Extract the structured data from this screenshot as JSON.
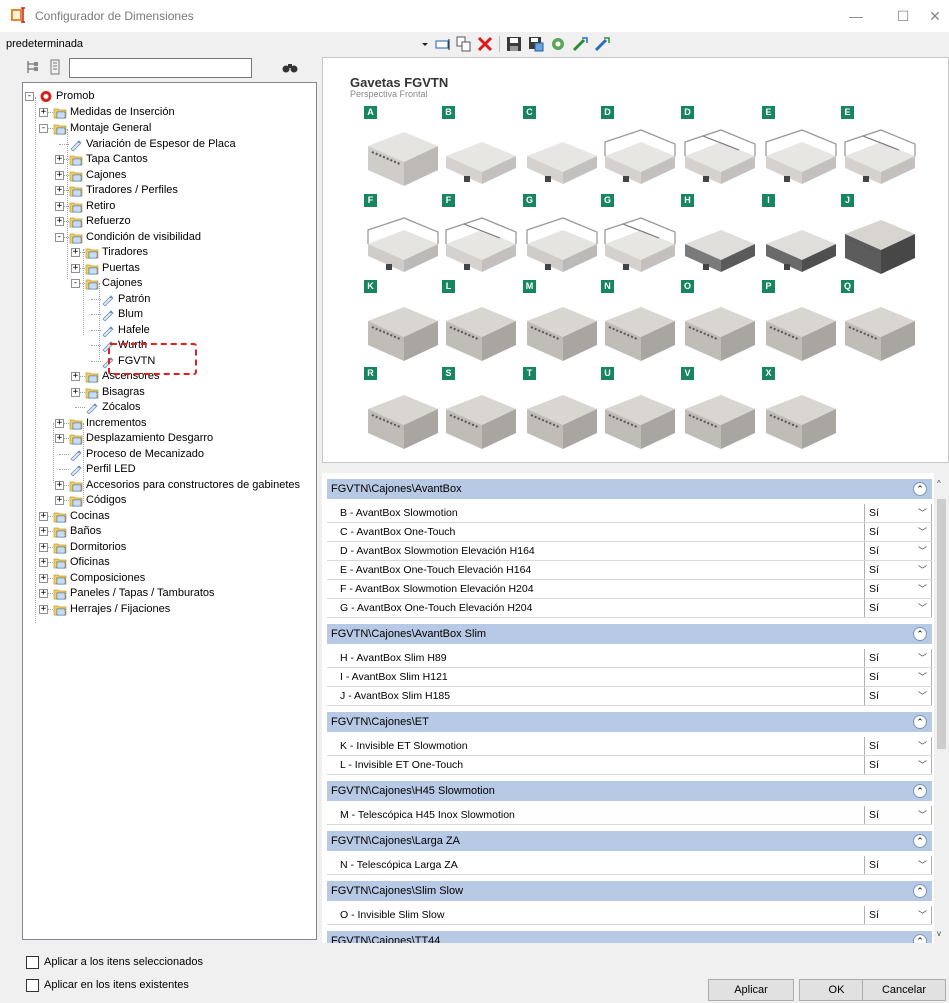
{
  "window": {
    "title": "Configurador de Dimensiones",
    "minimize": "—",
    "maximize": "☐",
    "close": "✕"
  },
  "toolbar": {
    "profile": "predeterminada"
  },
  "tree": {
    "nodes": [
      {
        "label": "Promob",
        "icon": "promob-icon"
      },
      {
        "label": "Medidas de Inserción",
        "icon": "folder-icon"
      },
      {
        "label": "Montaje General",
        "icon": "folder-icon"
      },
      {
        "label": "Variación de Espesor de Placa",
        "icon": "property-icon"
      },
      {
        "label": "Tapa Cantos",
        "icon": "folder-icon"
      },
      {
        "label": "Cajones",
        "icon": "folder-icon"
      },
      {
        "label": "Tiradores / Perfiles",
        "icon": "folder-icon"
      },
      {
        "label": "Retiro",
        "icon": "folder-icon"
      },
      {
        "label": "Refuerzo",
        "icon": "folder-icon"
      },
      {
        "label": "Condición de visibilidad",
        "icon": "folder-icon"
      },
      {
        "label": "Tiradores",
        "icon": "folder-icon"
      },
      {
        "label": "Puertas",
        "icon": "folder-icon"
      },
      {
        "label": "Cajones",
        "icon": "folder-icon"
      },
      {
        "label": "Patrón",
        "icon": "property-icon"
      },
      {
        "label": "Blum",
        "icon": "property-icon"
      },
      {
        "label": "Hafele",
        "icon": "property-icon"
      },
      {
        "label": "Wurth",
        "icon": "property-icon"
      },
      {
        "label": "FGVTN",
        "icon": "property-icon"
      },
      {
        "label": "Ascensores",
        "icon": "folder-icon"
      },
      {
        "label": "Bisagras",
        "icon": "folder-icon"
      },
      {
        "label": "Zócalos",
        "icon": "property-icon"
      },
      {
        "label": "Incrementos",
        "icon": "folder-icon"
      },
      {
        "label": "Desplazamiento Desgarro",
        "icon": "folder-icon"
      },
      {
        "label": "Proceso de Mecanizado",
        "icon": "property-icon"
      },
      {
        "label": "Perfil LED",
        "icon": "property-icon"
      },
      {
        "label": "Accesorios para constructores de gabinetes",
        "icon": "folder-icon"
      },
      {
        "label": "Códigos",
        "icon": "folder-icon"
      },
      {
        "label": "Cocinas",
        "icon": "folder-icon"
      },
      {
        "label": "Baños",
        "icon": "folder-icon"
      },
      {
        "label": "Dormitorios",
        "icon": "folder-icon"
      },
      {
        "label": "Oficinas",
        "icon": "folder-icon"
      },
      {
        "label": "Composiciones",
        "icon": "folder-icon"
      },
      {
        "label": "Paneles / Tapas / Tamburatos",
        "icon": "folder-icon"
      },
      {
        "label": "Herrajes / Fijaciones",
        "icon": "folder-icon"
      }
    ]
  },
  "preview": {
    "title": "Gavetas FGVTN",
    "subtitle": "Perspectiva Frontal",
    "tags": [
      "A",
      "B",
      "C",
      "D",
      "D",
      "E",
      "E",
      "F",
      "F",
      "G",
      "G",
      "H",
      "I",
      "J",
      "K",
      "L",
      "M",
      "N",
      "O",
      "P",
      "Q",
      "R",
      "S",
      "T",
      "U",
      "V",
      "X"
    ]
  },
  "props": {
    "groups": [
      {
        "title": "FGVTN\\Cajones\\AvantBox",
        "collapse": "⌃",
        "rows": [
          {
            "label": "B - AvantBox Slowmotion",
            "value": "Sí"
          },
          {
            "label": "C - AvantBox One-Touch",
            "value": "Sí"
          },
          {
            "label": "D - AvantBox Slowmotion Elevación H164",
            "value": "Sí"
          },
          {
            "label": "E - AvantBox One-Touch Elevación H164",
            "value": "Sí"
          },
          {
            "label": "F - AvantBox Slowmotion Elevación H204",
            "value": "Sí"
          },
          {
            "label": "G - AvantBox One-Touch Elevación H204",
            "value": "Sí"
          }
        ]
      },
      {
        "title": "FGVTN\\Cajones\\AvantBox Slim",
        "collapse": "⌃",
        "rows": [
          {
            "label": "H - AvantBox Slim H89",
            "value": "Sí"
          },
          {
            "label": "I - AvantBox Slim H121",
            "value": "Sí"
          },
          {
            "label": "J - AvantBox Slim H185",
            "value": "Sí"
          }
        ]
      },
      {
        "title": "FGVTN\\Cajones\\ET",
        "collapse": "⌃",
        "rows": [
          {
            "label": "K - Invisible ET Slowmotion",
            "value": "Sí"
          },
          {
            "label": "L - Invisible ET One-Touch",
            "value": "Sí"
          }
        ]
      },
      {
        "title": "FGVTN\\Cajones\\H45 Slowmotion",
        "collapse": "⌃",
        "rows": [
          {
            "label": "M - Telescópica H45 Inox Slowmotion",
            "value": "Sí"
          }
        ]
      },
      {
        "title": "FGVTN\\Cajones\\Larga ZA",
        "collapse": "⌃",
        "rows": [
          {
            "label": "N - Telescópica Larga ZA",
            "value": "Sí"
          }
        ]
      },
      {
        "title": "FGVTN\\Cajones\\Slim Slow",
        "collapse": "⌃",
        "rows": [
          {
            "label": "O - Invisible Slim Slow",
            "value": "Sí"
          }
        ]
      },
      {
        "title": "FGVTN\\Cajones\\TT44",
        "collapse": "⌃",
        "rows": []
      }
    ]
  },
  "footer": {
    "apply_selected": "Aplicar a los itens seleccionados",
    "apply_existing": "Aplicar en los itens existentes",
    "apply": "Aplicar",
    "ok": "OK",
    "cancel": "Cancelar"
  }
}
